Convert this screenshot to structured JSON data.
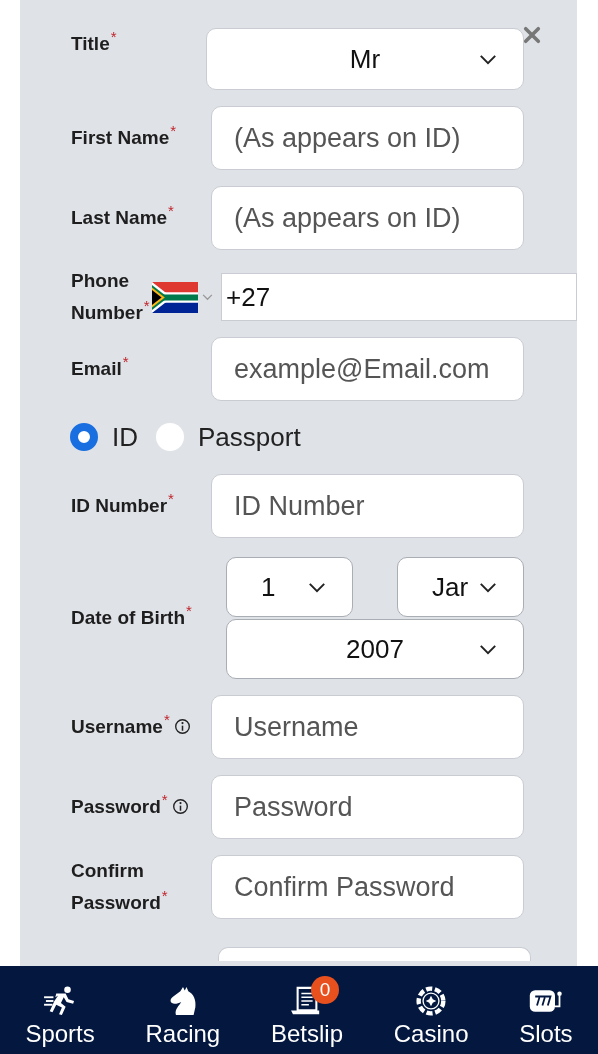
{
  "form": {
    "rows": [
      {
        "kind": "select",
        "label": "Title",
        "mark": "*",
        "value": "Mr"
      },
      {
        "kind": "text",
        "label": "First Name",
        "mark": "*",
        "placeholder": "(As appears on ID)"
      },
      {
        "kind": "text",
        "label": "Last Name",
        "mark": "*",
        "placeholder": "(As appears on ID)"
      },
      {
        "kind": "phone",
        "label": "Phone Number",
        "mark": "*",
        "value": "+27"
      },
      {
        "kind": "text",
        "label": "Email",
        "mark": "*",
        "placeholder": "example@Email.com"
      },
      {
        "kind": "radio",
        "options": [
          {
            "label": "ID",
            "selected": true
          },
          {
            "label": "Passport",
            "selected": false
          }
        ]
      },
      {
        "kind": "text",
        "label": "ID Number",
        "mark": "*",
        "placeholder": "ID Number"
      },
      {
        "kind": "dob",
        "label": "Date of Birth",
        "mark": "*",
        "day": "1",
        "month": "Jar",
        "year": "2007"
      },
      {
        "kind": "text",
        "label": "Username",
        "mark": "*",
        "info": true,
        "placeholder": "Username"
      },
      {
        "kind": "text",
        "label": "Password",
        "mark": "*",
        "info": true,
        "placeholder": "Password"
      },
      {
        "kind": "text",
        "label": "Confirm Password",
        "mark": "*",
        "placeholder": "Confirm Password"
      },
      {
        "kind": "cut"
      }
    ]
  },
  "nav": [
    {
      "kind": "sports",
      "label": "Sports"
    },
    {
      "kind": "racing",
      "label": "Racing"
    },
    {
      "kind": "betslip",
      "label": "Betslip",
      "badge": "0"
    },
    {
      "kind": "casino",
      "label": "Casino"
    },
    {
      "kind": "slots",
      "label": "Slots"
    }
  ]
}
